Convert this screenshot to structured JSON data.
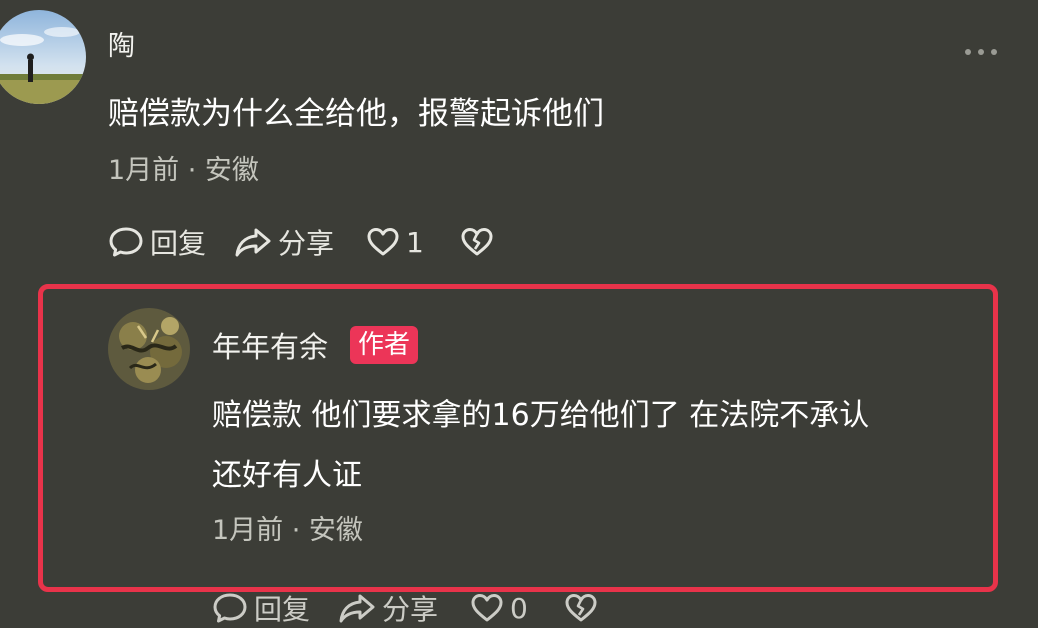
{
  "comment": {
    "username": "陶",
    "text": "赔偿款为什么全给他，报警起诉他们",
    "meta": "1月前 · 安徽",
    "actions": {
      "reply": "回复",
      "share": "分享",
      "likes": "1"
    }
  },
  "reply": {
    "username": "年年有余",
    "badge": "作者",
    "text_line1": "赔偿款 他们要求拿的16万给他们了 在法院不承认",
    "text_line2": "还好有人证",
    "meta": "1月前 · 安徽",
    "actions": {
      "reply": "回复",
      "share": "分享",
      "likes": "0"
    }
  },
  "colors": {
    "background": "#3c3d37",
    "highlight_border": "#e8334a",
    "author_badge": "#ec3558",
    "muted_text": "#c4c5bd"
  },
  "icons": [
    "more-icon",
    "comment-icon",
    "share-icon",
    "heart-icon",
    "broken-heart-icon"
  ]
}
